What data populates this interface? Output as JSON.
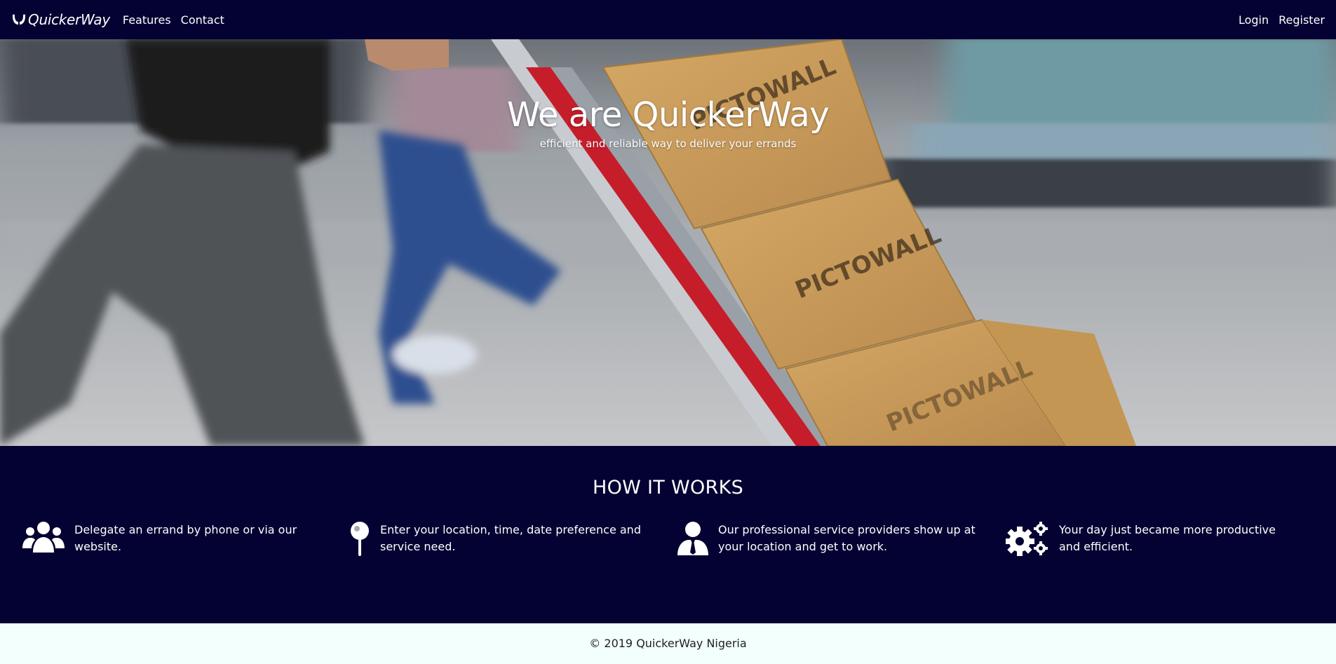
{
  "navbar": {
    "brand": "QuickerWay",
    "links": [
      "Features",
      "Contact"
    ],
    "right_links": [
      "Login",
      "Register"
    ]
  },
  "hero": {
    "title": "We are QuickerWay",
    "subtitle": "efficient and reliable way to deliver your errands"
  },
  "how_it_works": {
    "title": "HOW IT WORKS",
    "steps": [
      {
        "icon": "users-icon",
        "text": "Delegate an errand by phone or via our website."
      },
      {
        "icon": "map-pin-icon",
        "text": "Enter your location, time, date preference and service need."
      },
      {
        "icon": "user-tie-icon",
        "text": "Our professional service providers show up at your location and get to work."
      },
      {
        "icon": "cogs-icon",
        "text": "Your day just became more productive and efficient."
      }
    ]
  },
  "footer": {
    "copyright": "© 2019 QuickerWay Nigeria"
  },
  "colors": {
    "navy": "#030232",
    "footer_bg": "#f2fffd",
    "text_light": "#ffffff"
  }
}
